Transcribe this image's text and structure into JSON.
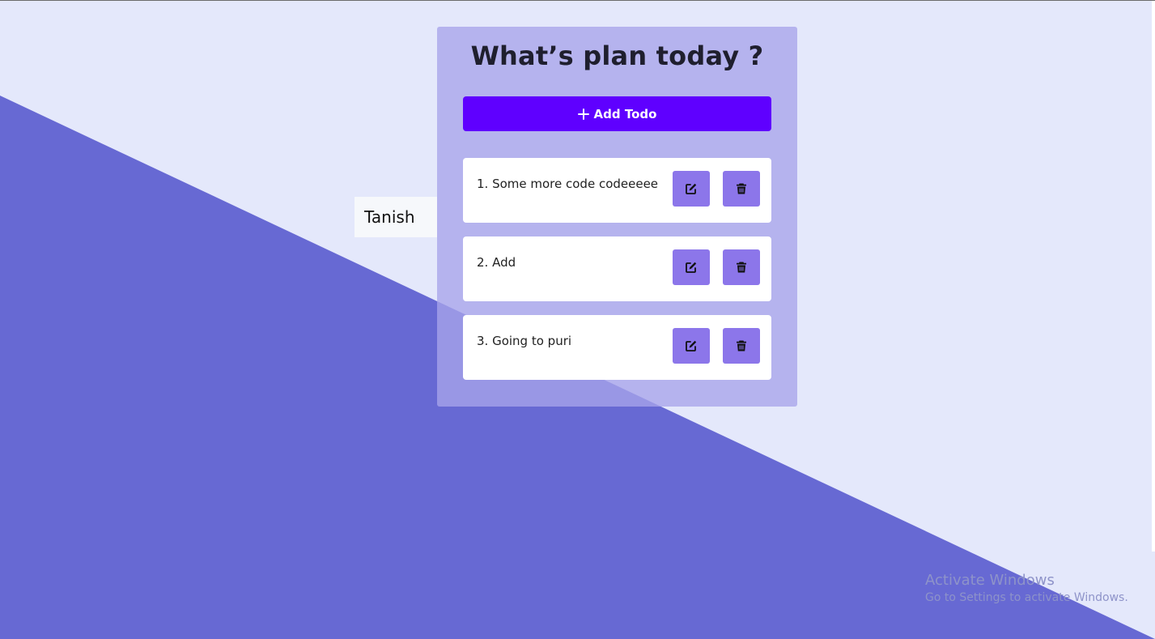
{
  "page": {
    "title": "What’s plan today ?"
  },
  "user": {
    "name": "Tanish"
  },
  "actions": {
    "add_label": "Add Todo",
    "add_icon": "plus-icon"
  },
  "todos": [
    {
      "text": "1. Some more code codeeeee",
      "edit_icon": "edit-icon",
      "delete_icon": "trash-icon"
    },
    {
      "text": "2. Add",
      "edit_icon": "edit-icon",
      "delete_icon": "trash-icon"
    },
    {
      "text": "3. Going to puri",
      "edit_icon": "edit-icon",
      "delete_icon": "trash-icon"
    }
  ],
  "watermark": {
    "title": "Activate Windows",
    "subtitle": "Go to Settings to activate Windows."
  },
  "colors": {
    "background_light": "#e4e8fb",
    "background_dark": "#6769d3",
    "card": "#a8a4eb",
    "primary_button": "#5f00ff",
    "icon_button": "#8c76ea",
    "todo_item": "#ffffff"
  }
}
